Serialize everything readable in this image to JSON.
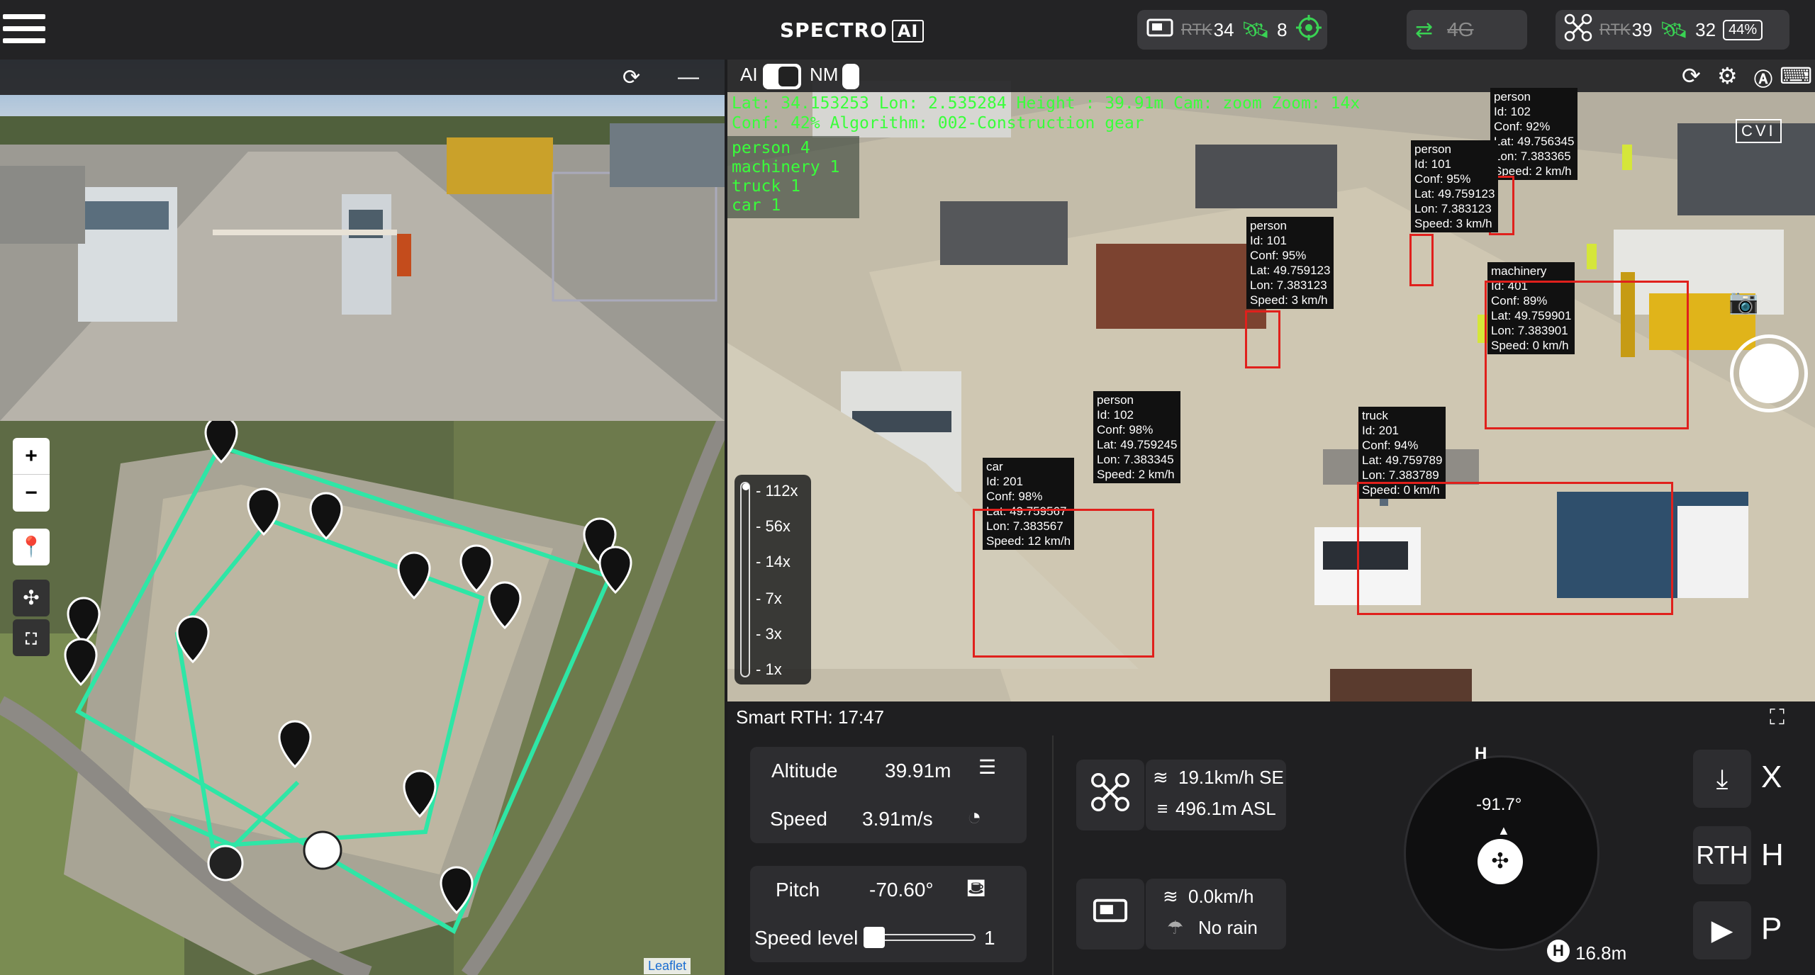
{
  "app": {
    "logo_text": "SPECTRO",
    "logo_badge": "AI"
  },
  "status": {
    "rc": {
      "rtk_label": "RTK",
      "rtk_value": "34",
      "sat_count": "8"
    },
    "link": {
      "network": "4G"
    },
    "drone": {
      "rtk_label": "RTK",
      "rtk_value": "39",
      "sat_count": "32",
      "battery": "44%",
      "battery_fraction": 0.44
    }
  },
  "camera": {
    "ai_label": "AI",
    "nm_label": "NM",
    "telemetry_line1": "Lat: 34.153253   Lon: 2.535284   Height : 39.91m  Cam: zoom  Zoom: 14x",
    "telemetry_line2": "Conf: 42%  Algorithm: 002-Construction gear",
    "counts": [
      "person 4",
      "machinery 1",
      "truck 1",
      "car 1"
    ],
    "cvi": "CVI",
    "zoom_levels": [
      "112x",
      "56x",
      "14x",
      "7x",
      "3x",
      "1x"
    ],
    "detections": [
      {
        "cls": "person",
        "id": "Id: 102",
        "conf": "Conf: 92%",
        "lat": "Lat: 49.756345",
        "lon": "Lon: 7.383365",
        "speed": "Speed: 2 km/h"
      },
      {
        "cls": "person",
        "id": "Id: 101",
        "conf": "Conf: 95%",
        "lat": "Lat: 49.759123",
        "lon": "Lon: 7.383123",
        "speed": "Speed: 3 km/h"
      },
      {
        "cls": "person",
        "id": "Id: 101",
        "conf": "Conf: 95%",
        "lat": "Lat: 49.759123",
        "lon": "Lon: 7.383123",
        "speed": "Speed: 3 km/h"
      },
      {
        "cls": "machinery",
        "id": "Id: 401",
        "conf": "Conf: 89%",
        "lat": "Lat: 49.759901",
        "lon": "Lon: 7.383901",
        "speed": "Speed: 0 km/h"
      },
      {
        "cls": "person",
        "id": "Id: 102",
        "conf": "Conf: 98%",
        "lat": "Lat: 49.759245",
        "lon": "Lon: 7.383345",
        "speed": "Speed: 2 km/h"
      },
      {
        "cls": "car",
        "id": "Id: 201",
        "conf": "Conf: 98%",
        "lat": "Lat: 49.759567",
        "lon": "Lon: 7.383567",
        "speed": "Speed: 12 km/h"
      },
      {
        "cls": "truck",
        "id": "Id: 201",
        "conf": "Conf: 94%",
        "lat": "Lat: 49.759789",
        "lon": "Lon: 7.383789",
        "speed": "Speed: 0 km/h"
      }
    ]
  },
  "map": {
    "zoom_in": "+",
    "zoom_out": "−",
    "attribution": "Leaflet"
  },
  "flight": {
    "rth_title": "Smart RTH: 17:47",
    "altitude_label": "Altitude",
    "altitude_value": "39.91m",
    "speed_label": "Speed",
    "speed_value": "3.91m/s",
    "pitch_label": "Pitch",
    "pitch_value": "-70.60°",
    "speed_level_label": "Speed level",
    "speed_level_value": "1",
    "wind_drone": "19.1km/h SE",
    "altitude_asl": "496.1m ASL",
    "wind_rc": "0.0km/h",
    "rain": "No rain",
    "heading": "-91.7°",
    "compass_H": "H",
    "home_distance": "16.8m",
    "home_label": "H",
    "modes": {
      "x": "X",
      "rth": "RTH",
      "h": "H",
      "p": "P"
    }
  }
}
